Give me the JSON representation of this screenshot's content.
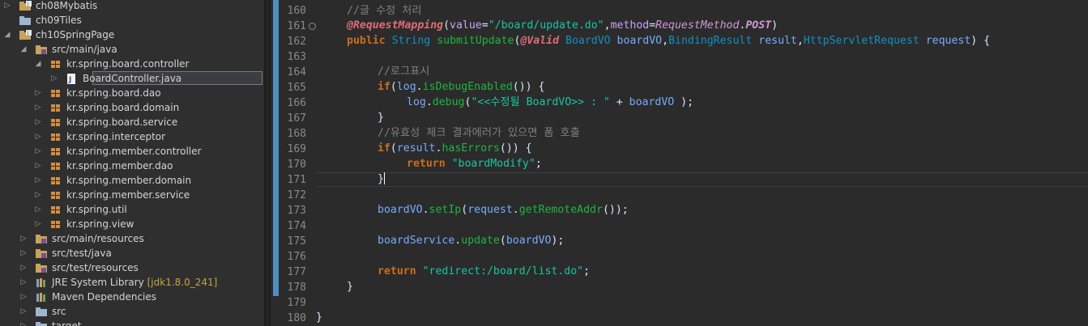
{
  "explorer": {
    "rows": [
      {
        "label": "ch08Mybatis",
        "decoration": "",
        "icon": "project-folder-icon",
        "twisty": "▷"
      },
      {
        "label": "ch09Tiles",
        "decoration": "",
        "icon": "folder-icon",
        "twisty": ""
      },
      {
        "label": "ch10SpringPage",
        "decoration": "",
        "icon": "project-folder-icon",
        "twisty": "◢"
      },
      {
        "label": "src/main/java",
        "decoration": "",
        "icon": "source-folder-icon",
        "twisty": "◢"
      },
      {
        "label": "kr.spring.board.controller",
        "decoration": "",
        "icon": "package-icon",
        "twisty": "◢"
      },
      {
        "label": "BoardController.java",
        "decoration": "",
        "icon": "java-file-icon",
        "twisty": "▷"
      },
      {
        "label": "kr.spring.board.dao",
        "decoration": "",
        "icon": "package-icon",
        "twisty": "▷"
      },
      {
        "label": "kr.spring.board.domain",
        "decoration": "",
        "icon": "package-icon",
        "twisty": "▷"
      },
      {
        "label": "kr.spring.board.service",
        "decoration": "",
        "icon": "package-icon",
        "twisty": "▷"
      },
      {
        "label": "kr.spring.interceptor",
        "decoration": "",
        "icon": "package-icon",
        "twisty": "▷"
      },
      {
        "label": "kr.spring.member.controller",
        "decoration": "",
        "icon": "package-icon",
        "twisty": "▷"
      },
      {
        "label": "kr.spring.member.dao",
        "decoration": "",
        "icon": "package-icon",
        "twisty": "▷"
      },
      {
        "label": "kr.spring.member.domain",
        "decoration": "",
        "icon": "package-icon",
        "twisty": "▷"
      },
      {
        "label": "kr.spring.member.service",
        "decoration": "",
        "icon": "package-icon",
        "twisty": "▷"
      },
      {
        "label": "kr.spring.util",
        "decoration": "",
        "icon": "package-icon",
        "twisty": "▷"
      },
      {
        "label": "kr.spring.view",
        "decoration": "",
        "icon": "package-icon",
        "twisty": "▷"
      },
      {
        "label": "src/main/resources",
        "decoration": "",
        "icon": "source-folder-icon",
        "twisty": "▷"
      },
      {
        "label": "src/test/java",
        "decoration": "",
        "icon": "source-folder-icon",
        "twisty": "▷"
      },
      {
        "label": "src/test/resources",
        "decoration": "",
        "icon": "source-folder-icon",
        "twisty": "▷"
      },
      {
        "label": "JRE System Library",
        "decoration": "[jdk1.8.0_241]",
        "icon": "library-icon",
        "twisty": "▷"
      },
      {
        "label": "Maven Dependencies",
        "decoration": "",
        "icon": "library-icon",
        "twisty": "▷"
      },
      {
        "label": "src",
        "decoration": "",
        "icon": "folder-icon",
        "twisty": "▷"
      },
      {
        "label": "target",
        "decoration": "",
        "icon": "folder-icon",
        "twisty": "▷"
      }
    ],
    "selected_label": "BoardController.java"
  },
  "editor": {
    "line_numbers": [
      "160",
      "161",
      "162",
      "163",
      "164",
      "165",
      "166",
      "167",
      "168",
      "169",
      "170",
      "171",
      "172",
      "173",
      "174",
      "175",
      "176",
      "177",
      "178",
      "179",
      "180"
    ],
    "current_line": "171",
    "lines": {
      "l160": {
        "comment": "//글 수정 처리"
      },
      "l161": {
        "annotation": "@RequestMapping",
        "p1": "(",
        "attr1": "value",
        "eq1": "=",
        "str1": "\"/board/update.do\"",
        "comma": ",",
        "attr2": "method",
        "eq2": "=",
        "enum_cls": "RequestMethod",
        "dot": ".",
        "enum_val": "POST",
        "p2": ")"
      },
      "l162": {
        "kw_public": "public",
        "type_string": "String",
        "method": "submitUpdate",
        "p1": "(",
        "ann_valid": "@Valid",
        "type_vo": "BoardVO",
        "param1": "boardVO",
        "comma1": ",",
        "type_br": "BindingResult",
        "param2": "result",
        "comma2": ",",
        "type_req": "HttpServletRequest",
        "param3": "request",
        "tail": ") {"
      },
      "l164": {
        "comment": "//로그표시"
      },
      "l165": {
        "kw_if": "if",
        "p1": "(",
        "var": "log",
        "dot": ".",
        "method": "isDebugEnabled",
        "tail": "()) {"
      },
      "l166": {
        "var": "log",
        "dot": ".",
        "method": "debug",
        "p1": "(",
        "str": "\"<<수정될 BoardVO>> : \"",
        "plus": " + ",
        "arg": "boardVO",
        "tail": " );"
      },
      "l167": {
        "brace": "}"
      },
      "l168": {
        "comment": "//유효성 체크 결과에러가 있으면 폼 호출"
      },
      "l169": {
        "kw_if": "if",
        "p1": "(",
        "var": "result",
        "dot": ".",
        "method": "hasErrors",
        "tail": "()) {"
      },
      "l170": {
        "kw_return": "return",
        "str": "\"boardModify\"",
        "semi": ";"
      },
      "l171": {
        "brace": "}"
      },
      "l173": {
        "var": "boardVO",
        "dot": ".",
        "method": "setIp",
        "p1": "(",
        "arg": "request",
        "dot2": ".",
        "method2": "getRemoteAddr",
        "tail": "());"
      },
      "l175": {
        "var": "boardService",
        "dot": ".",
        "method": "update",
        "p1": "(",
        "arg": "boardVO",
        "tail": ");"
      },
      "l177": {
        "kw_return": "return",
        "str": "\"redirect:/board/list.do\"",
        "semi": ";"
      },
      "l178": {
        "brace": "}"
      },
      "l180": {
        "brace": "}"
      }
    }
  },
  "colors": {
    "keyword": "#cc6c1d",
    "type": "#1290c3",
    "method": "#1eb540",
    "string": "#17c6a3",
    "comment": "#808080",
    "change_bar": "#4f8fbf"
  }
}
